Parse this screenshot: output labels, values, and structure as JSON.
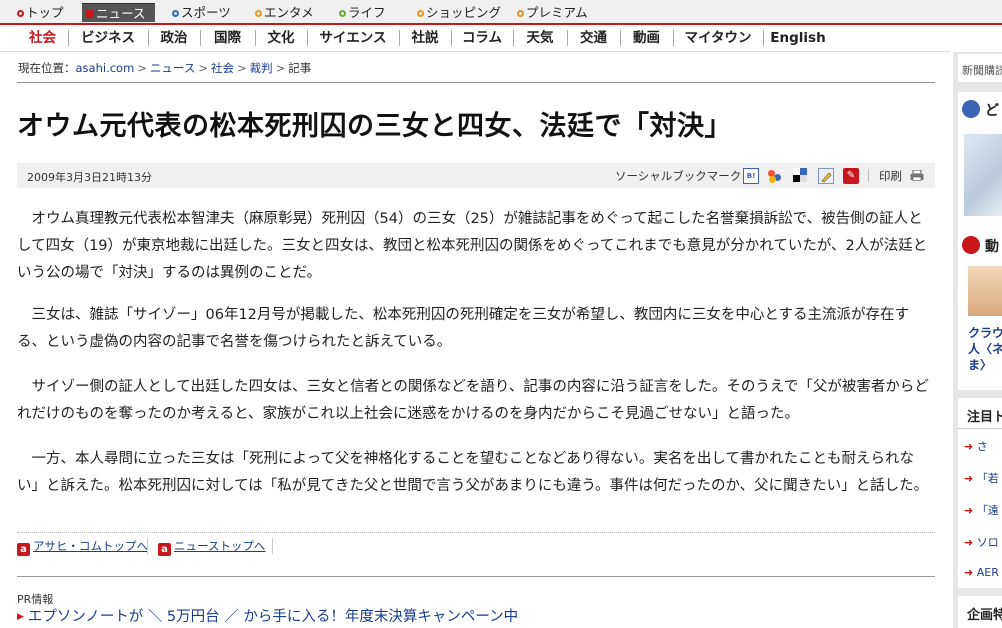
{
  "topnav": {
    "tabs": [
      {
        "label": "トップ",
        "dot": "#c8161d"
      },
      {
        "label": "ニュース",
        "dot": "#c8161d",
        "active": true
      },
      {
        "label": "スポーツ",
        "dot": "#3b64b4"
      },
      {
        "label": "エンタメ",
        "dot": "#e79a1e"
      },
      {
        "label": "ライフ",
        "dot": "#6aa83a"
      },
      {
        "label": "ショッピング",
        "dot": "#e79a1e"
      },
      {
        "label": "プレミアム",
        "dot": "#d49a1e"
      }
    ]
  },
  "catnav": {
    "items": [
      "社会",
      "ビジネス",
      "政治",
      "国際",
      "文化",
      "サイエンス",
      "社説",
      "コラム",
      "天気",
      "交通",
      "動画",
      "マイタウン",
      "English"
    ]
  },
  "breadcrumb": {
    "label": "現在位置：",
    "items": [
      "asahi.com",
      "ニュース",
      "社会",
      "裁判",
      "記事"
    ],
    "separator": ">"
  },
  "article": {
    "title": "オウム元代表の松本死刑囚の三女と四女、法廷で「対決」",
    "date": "2009年3月3日21時13分",
    "social_bookmark_label": "ソーシャルブックマーク",
    "print_label": "印刷",
    "paragraphs": [
      "オウム真理教元代表松本智津夫（麻原彰晃）死刑囚（54）の三女（25）が雑誌記事をめぐって起こした名誉棄損訴訟で、被告側の証人として四女（19）が東京地裁に出廷した。三女と四女は、教団と松本死刑囚の関係をめぐってこれまでも意見が分かれていたが、2人が法廷という公の場で「対決」するのは異例のことだ。",
      "三女は、雑誌「サイゾー」06年12月号が掲載した、松本死刑囚の死刑確定を三女が希望し、教団内に三女を中心とする主流派が存在する、という虚偽の内容の記事で名誉を傷つけられたと訴えている。",
      "サイゾー側の証人として出廷した四女は、三女と信者との関係などを語り、記事の内容に沿う証言をした。そのうえで「父が被害者からどれだけのものを奪ったのか考えると、家族がこれ以上社会に迷惑をかけるのを身内だからこそ見過ごせない」と語った。",
      "一方、本人尋問に立った三女は「死刑によって父を神格化することを望むことなどあり得ない。実名を出して書かれたことも耐えられない」と訴えた。松本死刑囚に対しては「私が見てきた父と世間で言う父があまりにも違う。事件は何だったのか、父に聞きたい」と話した。"
    ]
  },
  "footer_links": {
    "icon_letter": "a",
    "asahi_top": "アサヒ・コムトップへ",
    "news_top": "ニューストップへ"
  },
  "pr": {
    "label": "PR情報",
    "ad_text": "エプソンノートが ＼ 5万円台 ／ から手に入る！年度末決算キャンペーン中"
  },
  "sidebar": {
    "subscribe": "新聞購読",
    "sec1_title": "ど",
    "sec2_title": "動",
    "story_text": [
      "クラウ",
      "人〈ネ",
      "ま〉"
    ],
    "attention_title": "注目ト",
    "attention_items": [
      "さ",
      "「若",
      "「遠",
      "ソロ",
      "AER"
    ],
    "corp_title": "企画特"
  },
  "colors": {
    "brand_red": "#c8161d",
    "link_blue": "#1a3c8c",
    "icon_blue": "#3b64b4"
  }
}
